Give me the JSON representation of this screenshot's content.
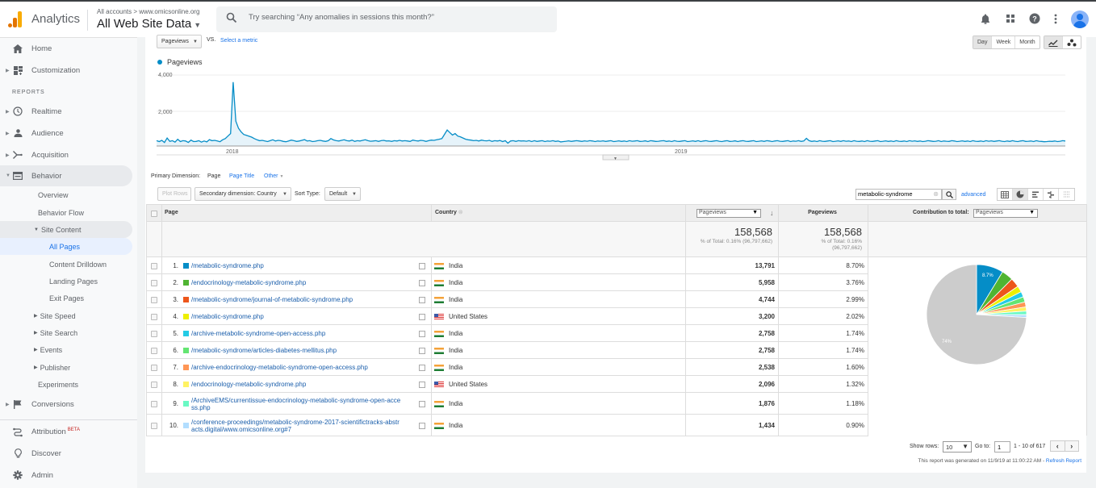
{
  "topbar": {
    "app_name": "Analytics",
    "breadcrumb_all": "All accounts",
    "breadcrumb_sep": ">",
    "breadcrumb_site": "www.omicsonline.org",
    "property": "All Web Site Data",
    "search_placeholder": "Try searching “Any anomalies in sessions this month?”",
    "icons": [
      "bell-icon",
      "apps-grid-icon",
      "help-icon",
      "more-vert-icon",
      "account-avatar"
    ]
  },
  "sidebar": {
    "home": "Home",
    "customization": "Customization",
    "reports_label": "REPORTS",
    "realtime": "Realtime",
    "audience": "Audience",
    "acquisition": "Acquisition",
    "behavior": "Behavior",
    "behavior_sub": {
      "overview": "Overview",
      "behavior_flow": "Behavior Flow",
      "site_content": "Site Content",
      "all_pages": "All Pages",
      "content_drilldown": "Content Drilldown",
      "landing_pages": "Landing Pages",
      "exit_pages": "Exit Pages",
      "site_speed": "Site Speed",
      "site_search": "Site Search",
      "events": "Events",
      "publisher": "Publisher",
      "experiments": "Experiments"
    },
    "conversions": "Conversions",
    "attribution": "Attribution",
    "attribution_badge": "BETA",
    "discover": "Discover",
    "admin": "Admin"
  },
  "chart_controls": {
    "metric": "Pageviews",
    "vs": "VS.",
    "select_metric": "Select a metric",
    "granularity": [
      "Day",
      "Week",
      "Month"
    ],
    "granularity_selected": "Day"
  },
  "chart_data": {
    "type": "line",
    "title": "",
    "legend": [
      "Pageviews"
    ],
    "series_color": "#058dc7",
    "y_ticks": [
      "4,000",
      "2,000"
    ],
    "ylim": [
      0,
      4500
    ],
    "x_ticks": [
      "2018",
      "2019"
    ],
    "grid": true,
    "series": [
      {
        "name": "Pageviews",
        "values": [
          300,
          250,
          320,
          200,
          450,
          260,
          300,
          220,
          380,
          250,
          300,
          280,
          200,
          330,
          250,
          260,
          300,
          220,
          280,
          230,
          360,
          300,
          320,
          280,
          240,
          350,
          420,
          560,
          700,
          3600,
          1400,
          1000,
          800,
          650,
          600,
          550,
          500,
          420,
          350,
          300,
          320,
          280,
          250,
          300,
          350,
          280,
          320,
          300,
          260,
          240,
          280,
          330,
          300,
          260,
          280,
          320,
          360,
          280,
          300,
          250,
          270,
          300,
          320,
          280,
          260,
          300,
          420,
          340,
          300,
          280,
          320,
          350,
          300,
          280,
          330,
          260,
          300,
          280,
          320,
          350,
          300,
          270,
          280,
          300,
          260,
          300,
          320,
          280,
          290,
          260,
          300,
          280,
          320,
          280,
          300,
          280,
          260,
          330,
          300,
          280,
          320,
          300,
          260,
          300,
          330,
          320,
          350,
          380,
          420,
          660,
          900,
          760,
          620,
          700,
          560,
          520,
          450,
          380,
          350,
          330,
          300,
          320,
          280,
          330,
          300,
          290,
          320,
          260,
          300,
          280,
          310,
          250,
          300,
          160,
          280,
          300,
          260,
          300,
          280,
          290,
          270,
          300,
          250,
          300,
          260,
          280,
          300,
          250,
          280,
          270,
          300,
          260,
          280,
          230,
          250,
          270,
          290,
          260,
          280,
          300,
          280,
          260,
          290,
          270,
          300,
          280,
          250,
          280,
          270,
          290,
          260,
          280,
          300,
          250,
          270,
          290,
          260,
          280,
          250,
          300,
          270,
          280,
          300,
          260,
          270,
          290,
          250,
          300,
          280,
          260,
          270,
          290,
          300,
          260,
          280,
          250,
          300,
          270,
          260,
          280,
          300,
          250,
          270,
          290,
          260,
          300,
          250,
          280,
          300,
          270,
          260,
          280,
          300,
          270,
          250,
          280,
          300,
          260,
          270,
          290,
          250,
          280,
          300,
          270,
          260,
          280,
          300,
          250,
          270,
          290,
          260,
          300,
          280,
          250,
          280,
          300,
          270,
          260,
          280,
          300,
          250,
          280,
          270,
          300,
          260,
          280,
          430,
          300,
          260,
          280,
          250,
          300,
          270,
          260,
          280,
          300,
          250,
          270,
          290,
          260,
          300,
          270,
          280,
          250,
          300,
          270,
          260,
          280,
          250,
          300,
          270,
          260,
          280,
          300,
          250,
          270,
          290,
          260,
          280,
          250,
          300,
          270,
          260,
          280,
          250,
          300,
          270,
          290,
          260,
          280,
          250,
          270,
          300,
          280,
          260,
          270,
          300,
          250,
          280,
          270,
          260,
          300,
          280,
          250,
          270,
          290,
          260,
          280,
          250,
          300,
          270,
          260,
          280,
          250,
          300,
          270,
          290,
          260,
          280,
          300,
          270,
          250,
          280,
          260,
          300,
          270,
          250,
          280,
          300,
          260,
          270,
          280,
          250,
          300,
          270,
          260,
          240,
          250,
          270,
          260,
          280,
          250,
          270,
          300,
          280
        ]
      }
    ]
  },
  "dimensions": {
    "label": "Primary Dimension:",
    "selected": "Page",
    "page_title": "Page Title",
    "other": "Other"
  },
  "toolbar": {
    "plot_rows": "Plot Rows",
    "secondary_dimension": "Secondary dimension: Country",
    "sort_type_label": "Sort Type:",
    "sort_type_value": "Default",
    "filter_value": "metabolic-syndrome",
    "advanced": "advanced",
    "view_icons": [
      "data-table-icon",
      "pie-chart-icon",
      "performance-bar-icon",
      "comparison-icon",
      "term-cloud-icon"
    ]
  },
  "table": {
    "headers": {
      "page": "Page",
      "country": "Country",
      "metric_select": "Pageviews",
      "pageviews": "Pageviews",
      "contribution_label": "Contribution to total:",
      "contribution_select": "Pageviews"
    },
    "totals": {
      "value": "158,568",
      "sub1": "% of Total: 0.16% (96,797,662)",
      "value2": "158,568",
      "sub2a": "% of Total: 0.16%",
      "sub2b": "(96,797,662)"
    },
    "rows": [
      {
        "num": "1.",
        "page": "/metabolic-syndrome.php",
        "country": "India",
        "flag": "in",
        "pageviews": "13,791",
        "pct": "8.70%",
        "color": "#058dc7"
      },
      {
        "num": "2.",
        "page": "/endocrinology-metabolic-syndrome.php",
        "country": "India",
        "flag": "in",
        "pageviews": "5,958",
        "pct": "3.76%",
        "color": "#50b432"
      },
      {
        "num": "3.",
        "page": "/metabolic-syndrome/journal-of-metabolic-syndrome.php",
        "country": "India",
        "flag": "in",
        "pageviews": "4,744",
        "pct": "2.99%",
        "color": "#ed561b"
      },
      {
        "num": "4.",
        "page": "/metabolic-syndrome.php",
        "country": "United States",
        "flag": "us",
        "pageviews": "3,200",
        "pct": "2.02%",
        "color": "#edef00"
      },
      {
        "num": "5.",
        "page": "/archive-metabolic-syndrome-open-access.php",
        "country": "India",
        "flag": "in",
        "pageviews": "2,758",
        "pct": "1.74%",
        "color": "#24cbe5"
      },
      {
        "num": "6.",
        "page": "/metabolic-syndrome/articles-diabetes-mellitus.php",
        "country": "India",
        "flag": "in",
        "pageviews": "2,758",
        "pct": "1.74%",
        "color": "#64e572"
      },
      {
        "num": "7.",
        "page": "/archive-endocrinology-metabolic-syndrome-open-access.php",
        "country": "India",
        "flag": "in",
        "pageviews": "2,538",
        "pct": "1.60%",
        "color": "#ff9655"
      },
      {
        "num": "8.",
        "page": "/endocrinology-metabolic-syndrome.php",
        "country": "United States",
        "flag": "us",
        "pageviews": "2,096",
        "pct": "1.32%",
        "color": "#fff263"
      },
      {
        "num": "9.",
        "page": "/ArchiveEMS/currentissue-endocrinology-metabolic-syndrome-open-access.php",
        "page_l1": "/ArchiveEMS/currentissue-endocrinology-metabolic-syndrome-open-acce",
        "page_l2": "ss.php",
        "country": "India",
        "flag": "in",
        "pageviews": "1,876",
        "pct": "1.18%",
        "color": "#6af9c4"
      },
      {
        "num": "10.",
        "page": "/conference-proceedings/metabolic-syndrome-2017-scientifictracks-abstracts.digital/www.omicsonline.org#7",
        "page_l1": "/conference-proceedings/metabolic-syndrome-2017-scientifictracks-abstr",
        "page_l2": "acts.digital/www.omicsonline.org#7",
        "country": "India",
        "flag": "in",
        "pageviews": "1,434",
        "pct": "0.90%",
        "color": "#b2deff"
      }
    ],
    "pie": {
      "slice_label_first": "8.7%",
      "slice_label_other": "74%",
      "other_color": "#cccccc",
      "other_pct": 73.93
    }
  },
  "pagination": {
    "show_rows_label": "Show rows:",
    "show_rows_value": "10",
    "goto_label": "Go to:",
    "goto_value": "1",
    "range": "1 - 10 of 617"
  },
  "footer": {
    "generated": "This report was generated on 11/9/19 at 11:00:22 AM - ",
    "refresh": "Refresh Report"
  }
}
